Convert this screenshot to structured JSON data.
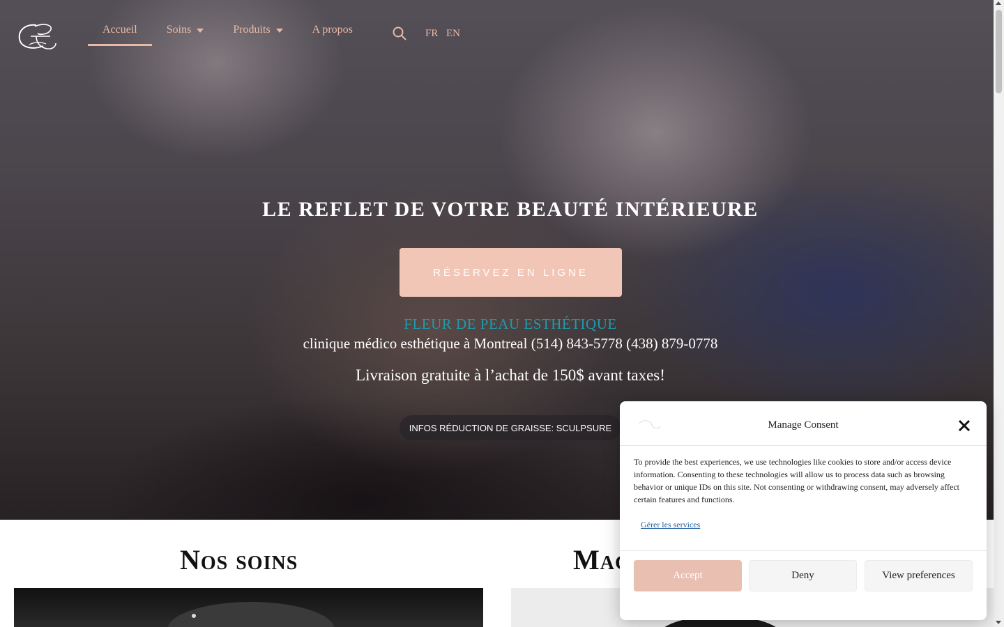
{
  "nav": {
    "items": [
      {
        "label": "Accueil"
      },
      {
        "label": "Soins"
      },
      {
        "label": "Produits"
      },
      {
        "label": "A propos"
      }
    ],
    "lang_fr": "FR",
    "lang_en": "EN"
  },
  "hero": {
    "title": "LE REFLET DE VOTRE BEAUTÉ INTÉRIEURE",
    "cta_label": "RÉSERVEZ EN LIGNE",
    "brand": "FLEUR DE PEAU ESTHÉTIQUE",
    "clinic": "clinique médico esthétique à Montreal (514) 843-5778 (438) 879-0778",
    "shipping": "Livraison gratuite à l’achat de 150$ avant taxes!",
    "info_pill": "INFOS RÉDUCTION DE GRAISSE: SCULPSURE"
  },
  "sections": {
    "left_title": "Nos soins",
    "right_title": "Mag"
  },
  "consent": {
    "title": "Manage Consent",
    "text": "To provide the best experiences, we use technologies like cookies to store and/or access device information. Consenting to these technologies will allow us to process data such as browsing behavior or unique IDs on this site. Not consenting or withdrawing consent, may adversely affect certain features and functions.",
    "manage_link": "Gérer les services",
    "accept_label": "Accept",
    "deny_label": "Deny",
    "prefs_label": "View preferences"
  },
  "colors": {
    "accent": "#e9b9a5",
    "cta": "#f2c6b7",
    "brand_teal": "#1f9aab"
  }
}
